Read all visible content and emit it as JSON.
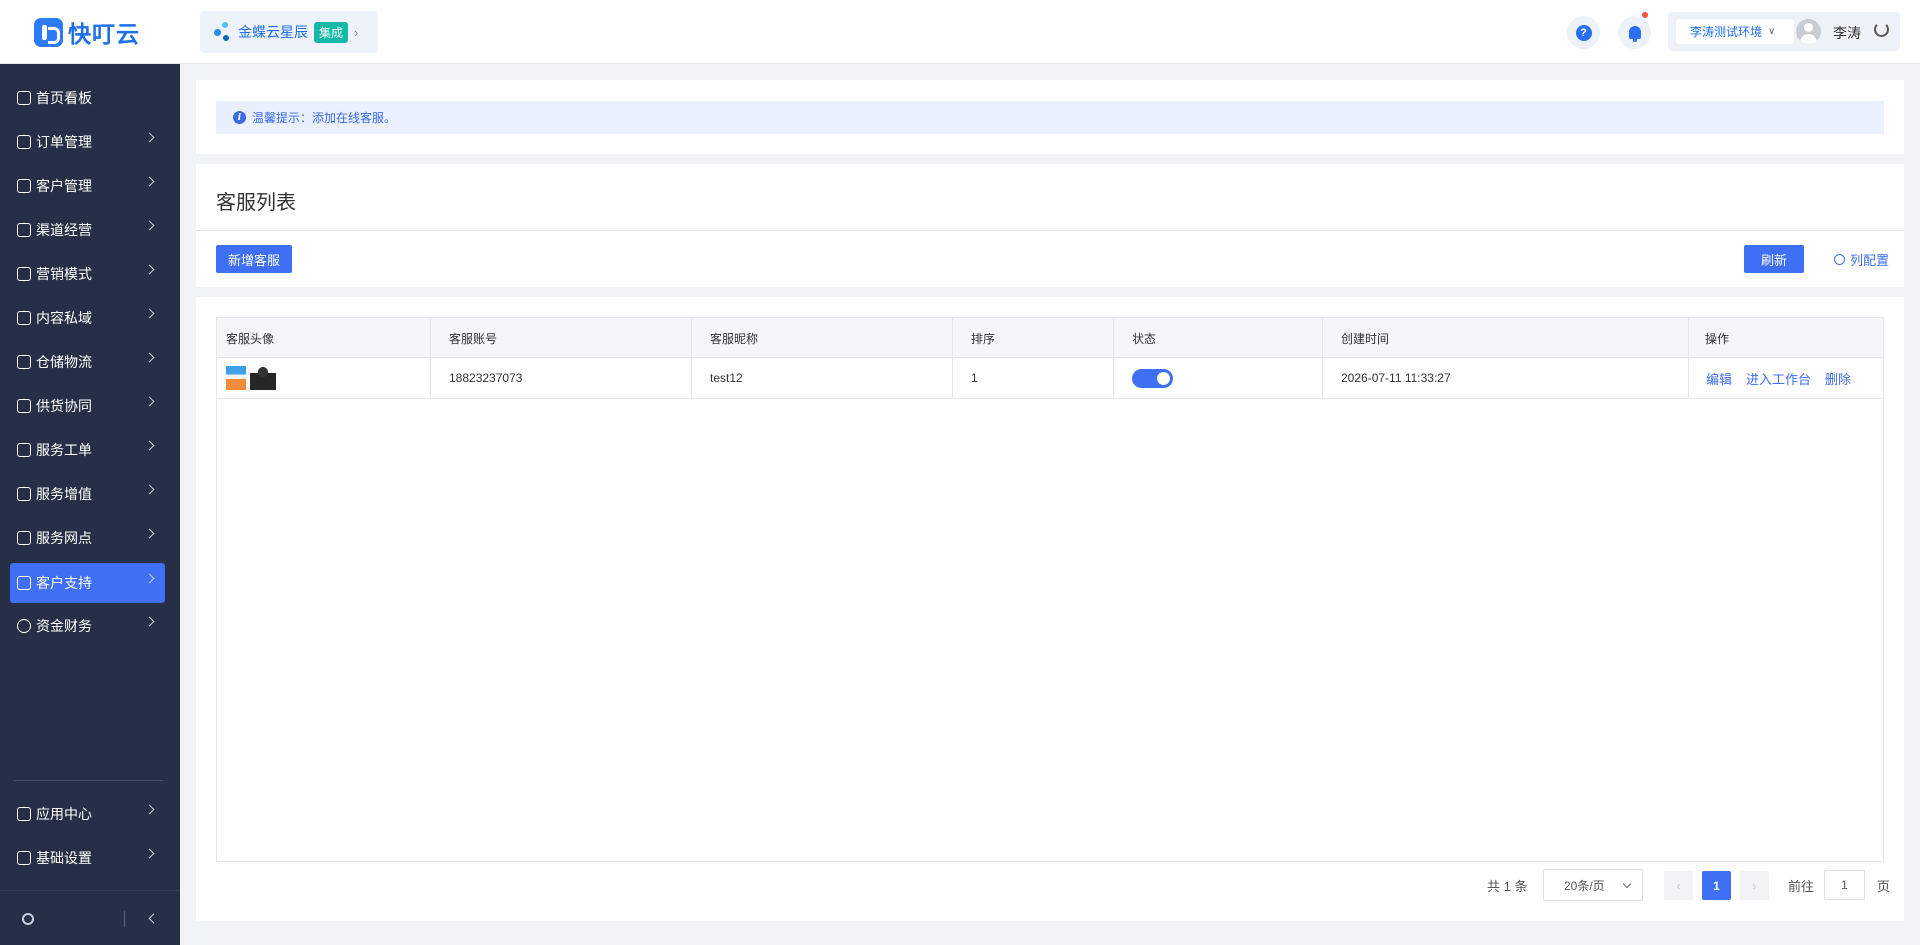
{
  "header": {
    "logo_text": "快叮云",
    "app_name": "金蝶云星辰",
    "app_tag": "集成",
    "help_glyph": "?",
    "env_select": "李涛测试环境",
    "user_name": "李涛",
    "icons": [
      "logo-icon",
      "app-dots-icon",
      "chevron-right-icon",
      "help-icon",
      "bell-icon",
      "chevron-down-icon",
      "avatar-icon",
      "refresh-icon"
    ]
  },
  "sidebar": {
    "items": [
      {
        "label": "首页看板",
        "icon": "home-icon",
        "has_children": false
      },
      {
        "label": "订单管理",
        "icon": "clipboard-icon",
        "has_children": true
      },
      {
        "label": "客户管理",
        "icon": "user-icon",
        "has_children": true
      },
      {
        "label": "渠道经营",
        "icon": "channel-icon",
        "has_children": true
      },
      {
        "label": "营销模式",
        "icon": "tag-icon",
        "has_children": true
      },
      {
        "label": "内容私域",
        "icon": "image-icon",
        "has_children": true
      },
      {
        "label": "仓储物流",
        "icon": "box-icon",
        "has_children": true
      },
      {
        "label": "供货协同",
        "icon": "supplier-icon",
        "has_children": true
      },
      {
        "label": "服务工单",
        "icon": "ticket-icon",
        "has_children": true
      },
      {
        "label": "服务增值",
        "icon": "bag-icon",
        "has_children": true
      },
      {
        "label": "服务网点",
        "icon": "store-icon",
        "has_children": true
      },
      {
        "label": "客户支持",
        "icon": "support-icon",
        "has_children": true,
        "active": true
      },
      {
        "label": "资金财务",
        "icon": "yen-icon",
        "has_children": true
      }
    ],
    "bottom_items": [
      {
        "label": "应用中心",
        "icon": "cube-icon",
        "has_children": true
      },
      {
        "label": "基础设置",
        "icon": "sliders-icon",
        "has_children": true
      }
    ]
  },
  "notice": {
    "text": "温馨提示：添加在线客服。"
  },
  "list": {
    "title": "客服列表",
    "add_button": "新增客服",
    "refresh_button": "刷新",
    "column_config": "列配置"
  },
  "table": {
    "columns": [
      "客服头像",
      "客服账号",
      "客服昵称",
      "排序",
      "状态",
      "创建时间",
      "操作"
    ],
    "rows": [
      {
        "account": "18823237073",
        "nickname": "test12",
        "sort": "1",
        "status_on": true,
        "created": "2026-07-11 11:33:27",
        "actions": [
          "编辑",
          "进入工作台",
          "删除"
        ]
      }
    ]
  },
  "pagination": {
    "total": "共 1 条",
    "page_size": "20条/页",
    "prev": "‹",
    "current_page": "1",
    "next": "›",
    "goto_label": "前往",
    "goto_value": "1",
    "page_unit": "页"
  },
  "colors": {
    "primary": "#3e6ff4",
    "sidebar_bg": "#262f45",
    "tag_teal": "#16b9a8",
    "notice_bg": "#eaf0fd",
    "badge_red": "#f5533d"
  }
}
